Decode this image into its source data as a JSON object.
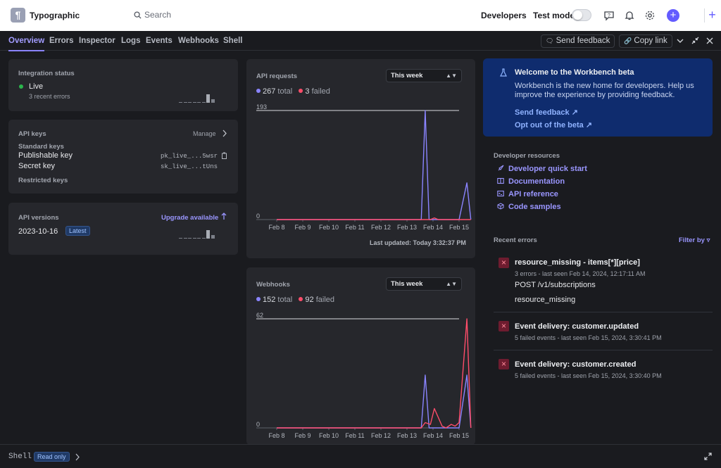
{
  "topbar": {
    "logo_glyph": "¶",
    "brand": "Typographic",
    "search_placeholder": "Search",
    "developers": "Developers",
    "test_mode": "Test mode",
    "icons": [
      "help-icon",
      "bell-icon",
      "gear-icon",
      "plus-icon"
    ]
  },
  "tabs": [
    "Overview",
    "Errors",
    "Inspector",
    "Logs",
    "Events",
    "Webhooks",
    "Shell"
  ],
  "toolbar": {
    "send_feedback": "Send feedback",
    "copy_link": "Copy link"
  },
  "integration": {
    "title": "Integration status",
    "status": "Live",
    "status_color": "#2bb54c",
    "errors": "3 recent errors"
  },
  "api_keys": {
    "title": "API keys",
    "manage": "Manage",
    "standard": "Standard keys",
    "publishable_label": "Publishable key",
    "publishable_value": "pk_live_...5wsr",
    "secret_label": "Secret key",
    "secret_value": "sk_live_...tUns",
    "restricted": "Restricted keys"
  },
  "api_versions": {
    "title": "API versions",
    "upgrade": "Upgrade available",
    "version": "2023-10-16",
    "latest": "Latest"
  },
  "api_requests": {
    "title": "API requests",
    "range": "This week",
    "total_count": "267",
    "total_label": "total",
    "failed_count": "3",
    "failed_label": "failed",
    "updated": "Last updated: Today 3:32:37 PM"
  },
  "webhooks": {
    "title": "Webhooks",
    "range": "This week",
    "total_count": "152",
    "total_label": "total",
    "failed_count": "92",
    "failed_label": "failed"
  },
  "chart_data": [
    {
      "type": "line",
      "title": "API requests",
      "x": [
        "Feb 8",
        "Feb 9",
        "Feb 10",
        "Feb 11",
        "Feb 12",
        "Feb 13",
        "Feb 14",
        "Feb 15"
      ],
      "ylim": [
        0,
        193
      ],
      "yticks": [
        "193",
        "0"
      ],
      "colors": {
        "total": "#8a84ff",
        "failed": "#ff4d6a"
      },
      "series": [
        {
          "name": "total",
          "points": [
            [
              0,
              0
            ],
            [
              5.55,
              0
            ],
            [
              5.7,
              193
            ],
            [
              5.85,
              0
            ],
            [
              7.0,
              0
            ],
            [
              7.3,
              65
            ],
            [
              7.45,
              0
            ]
          ]
        },
        {
          "name": "failed",
          "points": [
            [
              0,
              0
            ],
            [
              5.9,
              0
            ],
            [
              6.05,
              3
            ],
            [
              6.2,
              0
            ],
            [
              7.45,
              0
            ]
          ]
        }
      ]
    },
    {
      "type": "line",
      "title": "Webhooks",
      "x": [
        "Feb 8",
        "Feb 9",
        "Feb 10",
        "Feb 11",
        "Feb 12",
        "Feb 13",
        "Feb 14",
        "Feb 15"
      ],
      "ylim": [
        0,
        62
      ],
      "yticks": [
        "62",
        "0"
      ],
      "colors": {
        "total": "#8a84ff",
        "failed": "#ff4d6a"
      },
      "series": [
        {
          "name": "total",
          "points": [
            [
              0,
              0
            ],
            [
              5.55,
              0
            ],
            [
              5.7,
              30
            ],
            [
              5.85,
              0
            ],
            [
              7.0,
              0
            ],
            [
              7.3,
              30
            ],
            [
              7.45,
              0
            ]
          ]
        },
        {
          "name": "failed",
          "points": [
            [
              0,
              0
            ],
            [
              5.55,
              0
            ],
            [
              5.7,
              3
            ],
            [
              5.9,
              2
            ],
            [
              6.05,
              11
            ],
            [
              6.2,
              6
            ],
            [
              6.35,
              1
            ],
            [
              6.5,
              0
            ],
            [
              6.7,
              2
            ],
            [
              6.85,
              1
            ],
            [
              7.0,
              3
            ],
            [
              7.3,
              62
            ],
            [
              7.45,
              0
            ]
          ]
        }
      ]
    }
  ],
  "beta": {
    "title": "Welcome to the Workbench beta",
    "body": "Workbench is the new home for developers. Help us improve the experience by providing feedback.",
    "send_feedback": "Send feedback",
    "opt_out": "Opt out of the beta"
  },
  "resources": {
    "title": "Developer resources",
    "items": [
      "Developer quick start",
      "Documentation",
      "API reference",
      "Code samples"
    ]
  },
  "recent_errors": {
    "title": "Recent errors",
    "filter": "Filter by",
    "items": [
      {
        "title": "resource_missing - items[*][price]",
        "meta": "3 errors - last seen  Feb 14, 2024, 12:17:11 AM",
        "line1": "POST /v1/subscriptions",
        "line2": "resource_missing"
      },
      {
        "title": "Event delivery: customer.updated",
        "meta": "5 failed events - last seen  Feb 15, 2024, 3:30:41 PM"
      },
      {
        "title": "Event delivery: customer.created",
        "meta": "5 failed events - last seen  Feb 15, 2024, 3:30:40 PM"
      }
    ]
  },
  "shell": {
    "label": "Shell",
    "badge": "Read only"
  }
}
